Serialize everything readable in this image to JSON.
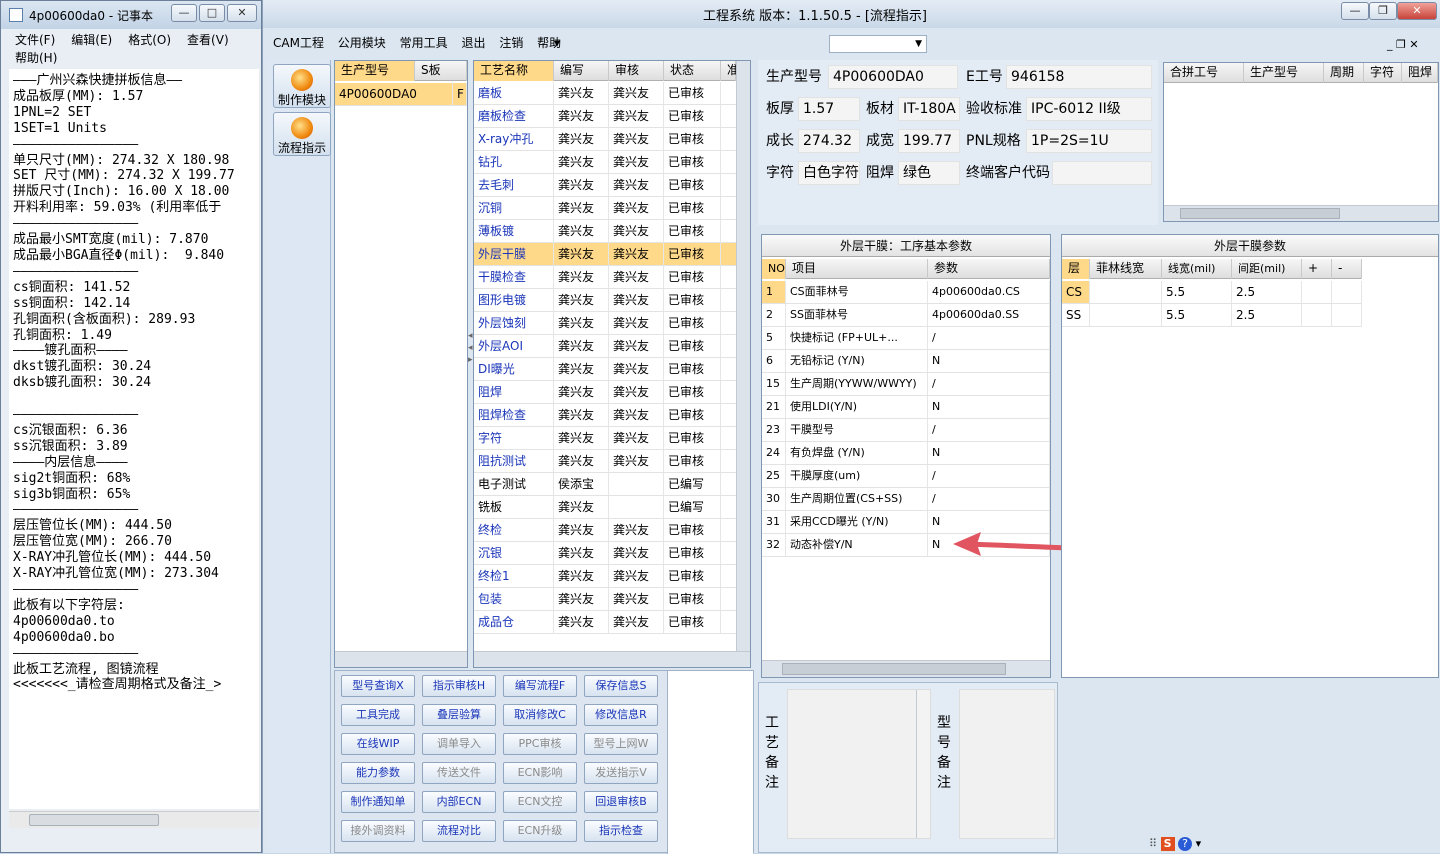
{
  "notepad": {
    "title": "4p00600da0 - 记事本",
    "menu": [
      "文件(F)",
      "编辑(E)",
      "格式(O)",
      "查看(V)",
      "帮助(H)"
    ],
    "lines": [
      "———广州兴森快捷拼板信息——",
      "成品板厚(MM): 1.57",
      "1PNL=2 SET",
      "1SET=1 Units",
      "————————————————",
      "单只尺寸(MM): 274.32 X 180.98",
      "SET 尺寸(MM): 274.32 X 199.77",
      "拼版尺寸(Inch): 16.00 X 18.00",
      "开料利用率: 59.03% (利用率低于",
      "————————————————",
      "成品最小SMT宽度(mil): 7.870",
      "成品最小BGA直径Φ(mil):  9.840",
      "————————————————",
      "cs铜面积: 141.52",
      "ss铜面积: 142.14",
      "孔铜面积(含板面积): 289.93",
      "孔铜面积: 1.49",
      "————镀孔面积————",
      "dkst镀孔面积: 30.24",
      "dksb镀孔面积: 30.24",
      "",
      "————————————————",
      "cs沉银面积: 6.36",
      "ss沉银面积: 3.89",
      "————内层信息————",
      "sig2t铜面积: 68%",
      "sig3b铜面积: 65%",
      "————————————————",
      "层压管位长(MM): 444.50",
      "层压管位宽(MM): 266.70",
      "X-RAY冲孔管位长(MM): 444.50",
      "X-RAY冲孔管位宽(MM): 273.304",
      "————————————————",
      "此板有以下字符层:",
      "4p00600da0.to",
      "4p00600da0.bo",
      "————————————————",
      "此板工艺流程, 图镜流程",
      "<<<<<<<_请检查周期格式及备注_>"
    ]
  },
  "main": {
    "title": "工程系统   版本：1.1.50.5 - [流程指示]",
    "menu": [
      "CAM工程",
      "公用模块",
      "常用工具",
      "退出",
      "注销",
      "帮助"
    ],
    "left_buttons": [
      "制作模块",
      "流程指示"
    ],
    "product_grid": {
      "headers": [
        "生产型号",
        "S板"
      ],
      "rows": [
        [
          "4P00600DA0",
          "F"
        ]
      ]
    },
    "process_grid": {
      "headers": [
        "工艺名称",
        "编写",
        "审核",
        "状态",
        "准"
      ],
      "rows": [
        [
          "磨板",
          "龚兴友",
          "龚兴友",
          "已审核"
        ],
        [
          "磨板检查",
          "龚兴友",
          "龚兴友",
          "已审核"
        ],
        [
          "X-ray冲孔",
          "龚兴友",
          "龚兴友",
          "已审核"
        ],
        [
          "钻孔",
          "龚兴友",
          "龚兴友",
          "已审核"
        ],
        [
          "去毛刺",
          "龚兴友",
          "龚兴友",
          "已审核"
        ],
        [
          "沉铜",
          "龚兴友",
          "龚兴友",
          "已审核"
        ],
        [
          "薄板镀",
          "龚兴友",
          "龚兴友",
          "已审核"
        ],
        [
          "外层干膜",
          "龚兴友",
          "龚兴友",
          "已审核"
        ],
        [
          "干膜检查",
          "龚兴友",
          "龚兴友",
          "已审核"
        ],
        [
          "图形电镀",
          "龚兴友",
          "龚兴友",
          "已审核"
        ],
        [
          "外层蚀刻",
          "龚兴友",
          "龚兴友",
          "已审核"
        ],
        [
          "外层AOI",
          "龚兴友",
          "龚兴友",
          "已审核"
        ],
        [
          "DI曝光",
          "龚兴友",
          "龚兴友",
          "已审核"
        ],
        [
          "阻焊",
          "龚兴友",
          "龚兴友",
          "已审核"
        ],
        [
          "阻焊检查",
          "龚兴友",
          "龚兴友",
          "已审核"
        ],
        [
          "字符",
          "龚兴友",
          "龚兴友",
          "已审核"
        ],
        [
          "阻抗测试",
          "龚兴友",
          "龚兴友",
          "已审核"
        ],
        [
          "电子测试",
          "侯添宝",
          "",
          "已编写"
        ],
        [
          "铣板",
          "龚兴友",
          "",
          "已编写"
        ],
        [
          "终检",
          "龚兴友",
          "龚兴友",
          "已审核"
        ],
        [
          "沉银",
          "龚兴友",
          "龚兴友",
          "已审核"
        ],
        [
          "终检1",
          "龚兴友",
          "龚兴友",
          "已审核"
        ],
        [
          "包装",
          "龚兴友",
          "龚兴友",
          "已审核"
        ],
        [
          "成品仓",
          "龚兴友",
          "龚兴友",
          "已审核"
        ]
      ],
      "selected_index": 7
    },
    "info": {
      "labels": {
        "prod_no": "生产型号",
        "e_no": "E工号",
        "thickness": "板厚",
        "material": "板材",
        "standard": "验收标准",
        "length": "成长",
        "width": "成宽",
        "pnl": "PNL规格",
        "char": "字符",
        "mask": "阻焊",
        "customer": "终端客户代码"
      },
      "values": {
        "prod_no": "4P00600DA0",
        "e_no": "946158",
        "thickness": "1.57",
        "material": "IT-180A",
        "standard": "IPC-6012 II级",
        "length": "274.32",
        "width": "199.77",
        "pnl": "1P=2S=1U",
        "char": "白色字符",
        "mask": "绿色",
        "customer": ""
      }
    },
    "merge_grid": {
      "headers": [
        "合拼工号",
        "生产型号",
        "周期",
        "字符",
        "阻焊"
      ]
    },
    "basic_params": {
      "title": "外层干膜：工序基本参数",
      "headers": [
        "NO",
        "项目",
        "参数"
      ],
      "rows": [
        [
          "1",
          "CS面菲林号",
          "4p00600da0.CS"
        ],
        [
          "2",
          "SS面菲林号",
          "4p00600da0.SS"
        ],
        [
          "5",
          "快捷标记 (FP+UL+...",
          "/"
        ],
        [
          "6",
          "无铅标记 (Y/N)",
          "N"
        ],
        [
          "15",
          "生产周期(YYWW/WWYY)",
          "/"
        ],
        [
          "21",
          "使用LDI(Y/N)",
          "N"
        ],
        [
          "23",
          "干膜型号",
          "/"
        ],
        [
          "24",
          "有负焊盘 (Y/N)",
          "N"
        ],
        [
          "25",
          "干膜厚度(um)",
          "/"
        ],
        [
          "30",
          "生产周期位置(CS+SS)",
          "/"
        ],
        [
          "31",
          "采用CCD曝光 (Y/N)",
          "N"
        ],
        [
          "32",
          "动态补偿Y/N",
          "N"
        ]
      ]
    },
    "film_params": {
      "title": "外层干膜参数",
      "headers": [
        "层",
        "菲林线宽",
        "线宽(mil)",
        "间距(mil)",
        "+",
        "-"
      ],
      "rows": [
        [
          "CS",
          "",
          "5.5",
          "2.5",
          "",
          ""
        ],
        [
          "SS",
          "",
          "5.5",
          "2.5",
          "",
          ""
        ]
      ]
    },
    "buttons": [
      [
        "型号查询X",
        "指示审核H",
        "编写流程F",
        "保存信息S"
      ],
      [
        "工具完成",
        "叠层验算",
        "取消修改C",
        "修改信息R"
      ],
      [
        "在线WIP",
        "调单导入",
        "PPC审核",
        "型号上网W"
      ],
      [
        "能力参数",
        "传送文件",
        "ECN影响",
        "发送指示V"
      ],
      [
        "制作通知单",
        "内部ECN",
        "ECN文控",
        "回退审核B"
      ],
      [
        "接外调资料",
        "流程对比",
        "ECN升级",
        "指示检查"
      ]
    ],
    "disabled_buttons": [
      "调单导入",
      "PPC审核",
      "型号上网W",
      "传送文件",
      "ECN影响",
      "发送指示V",
      "ECN文控",
      "ECN升级",
      "接外调资料"
    ],
    "notes": {
      "process_label": "工艺备注",
      "model_label": "型号备注"
    },
    "accent": "#ffd98a",
    "arrow_color": "#e05560"
  }
}
